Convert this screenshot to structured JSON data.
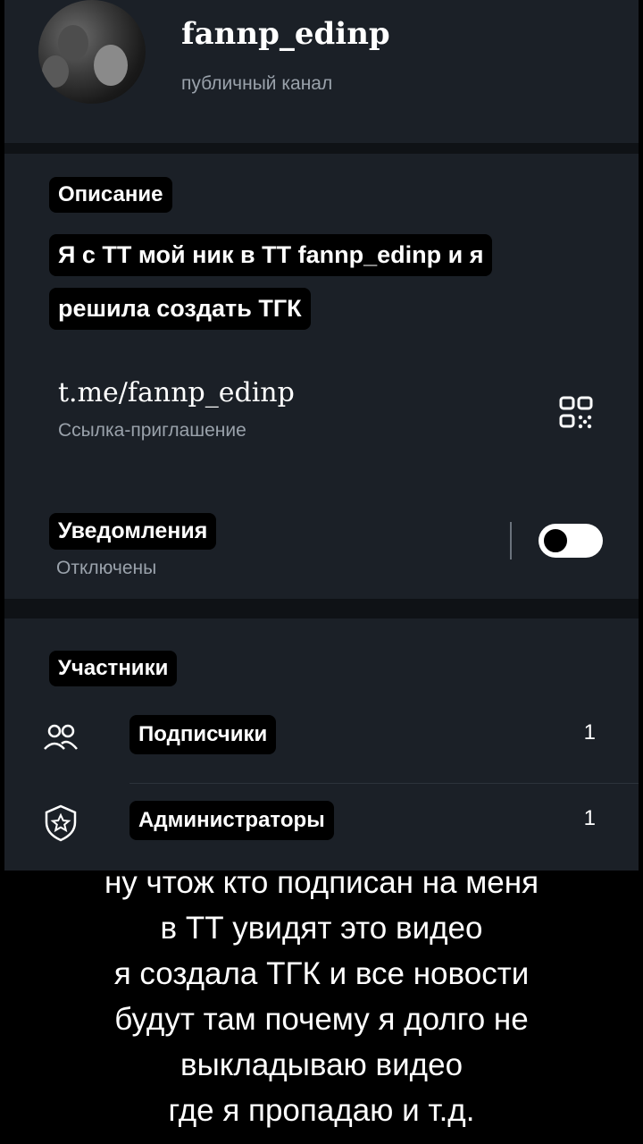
{
  "channel": {
    "name": "fannp_edinp",
    "type": "публичный канал"
  },
  "description": {
    "label": "Описание",
    "lines": [
      "Я с ТТ мой ник в ТТ fannp_edinp и я",
      "решила создать ТГК"
    ]
  },
  "link": {
    "url": "t.me/fannp_edinp",
    "label": "Ссылка-приглашение",
    "qr_icon": "qr-code-icon"
  },
  "notifications": {
    "label": "Уведомления",
    "status": "Отключены",
    "enabled": false
  },
  "members": {
    "label": "Участники",
    "items": [
      {
        "label": "Подписчики",
        "count": "1",
        "icon": "subscribers-icon"
      },
      {
        "label": "Администраторы",
        "count": "1",
        "icon": "admin-shield-icon"
      }
    ]
  },
  "caption": {
    "lines": [
      "ну чтож кто подписан на меня",
      "в ТТ увидят это видео",
      "я создала ТГК и все новости",
      "будут там почему я долго не",
      "выкладываю видео",
      "где я пропадаю и т.д."
    ]
  },
  "colors": {
    "panel": "#1b2027",
    "background": "#000000",
    "secondary_text": "#9aa2ab"
  }
}
